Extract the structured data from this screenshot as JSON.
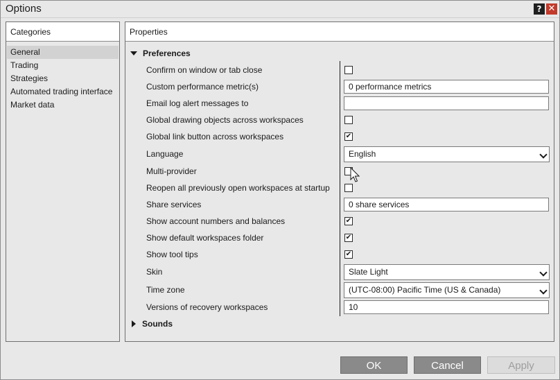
{
  "window": {
    "title": "Options"
  },
  "titlebar": {
    "help_label": "?",
    "close_label": "✕"
  },
  "categories": {
    "header": "Categories",
    "items": [
      {
        "label": "General",
        "selected": true
      },
      {
        "label": "Trading",
        "selected": false
      },
      {
        "label": "Strategies",
        "selected": false
      },
      {
        "label": "Automated trading interface",
        "selected": false
      },
      {
        "label": "Market data",
        "selected": false
      }
    ]
  },
  "properties": {
    "header": "Properties",
    "sections": [
      {
        "label": "Preferences",
        "expanded": true
      },
      {
        "label": "Sounds",
        "expanded": false
      }
    ],
    "rows": [
      {
        "label": "Confirm on window or tab close",
        "type": "checkbox",
        "checked": false
      },
      {
        "label": "Custom performance metric(s)",
        "type": "text",
        "value": "0 performance metrics"
      },
      {
        "label": "Email log alert messages to",
        "type": "text",
        "value": ""
      },
      {
        "label": "Global drawing objects across workspaces",
        "type": "checkbox",
        "checked": false
      },
      {
        "label": "Global link button across workspaces",
        "type": "checkbox",
        "checked": true
      },
      {
        "label": "Language",
        "type": "select",
        "value": "English"
      },
      {
        "label": "Multi-provider",
        "type": "checkbox",
        "checked": false
      },
      {
        "label": "Reopen all previously open workspaces at startup",
        "type": "checkbox",
        "checked": false
      },
      {
        "label": "Share services",
        "type": "text",
        "value": "0 share services"
      },
      {
        "label": "Show account numbers and balances",
        "type": "checkbox",
        "checked": true
      },
      {
        "label": "Show default workspaces folder",
        "type": "checkbox",
        "checked": true
      },
      {
        "label": "Show tool tips",
        "type": "checkbox",
        "checked": true
      },
      {
        "label": "Skin",
        "type": "select",
        "value": "Slate Light"
      },
      {
        "label": "Time zone",
        "type": "select",
        "value": "(UTC-08:00) Pacific Time (US & Canada)"
      },
      {
        "label": "Versions of recovery workspaces",
        "type": "text",
        "value": "10"
      }
    ]
  },
  "buttons": {
    "ok": "OK",
    "cancel": "Cancel",
    "apply": "Apply"
  },
  "check_glyph": "✔",
  "colors": {
    "button_bg": "#8a8a8a",
    "close_red": "#c23a2b"
  }
}
